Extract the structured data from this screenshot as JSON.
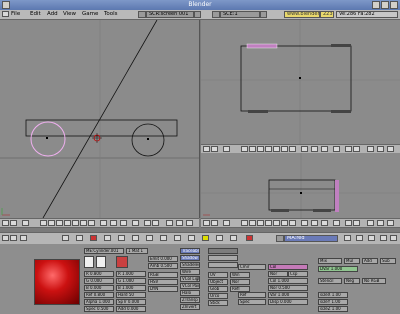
{
  "window": {
    "title": "Blender"
  },
  "menu": {
    "file": "File",
    "edit": "Edit",
    "add": "Add",
    "view": "View",
    "game": "Game",
    "tools": "Tools"
  },
  "screen_selector": "SCR:screen 001",
  "scene_selector": "SCE:1",
  "url_label": "www.blender.nl",
  "version_number": "223",
  "stats": "Ve:286 Fa:282",
  "viewport_top_right": {
    "cube_front_label": "|||||||||||||||",
    "cube_back_left": "|||||||||||",
    "cube_back_right": "|||||||||||"
  },
  "material": {
    "name": "MA:red",
    "ob_label": "ME:Cylinder.001",
    "slot": "1 Mat 1",
    "preset_tabs": [
      "RGB",
      "HSV",
      "DYN"
    ],
    "rgb": {
      "r": "R 0.800",
      "g": "G 0.000",
      "b": "B 0.000"
    },
    "spec": {
      "r": "R 1.000",
      "g": "G 1.000",
      "b": "B 1.000"
    },
    "params": [
      "Ref 0.800",
      "Alpha 1.000",
      "Spec 0.500",
      "Hard 50",
      "SpTr 0.000",
      "Add 0.000",
      "Emit 0.000",
      "Amb 0.500"
    ],
    "options": [
      "Traceable",
      "Shadow",
      "Shadeless",
      "Wire",
      "VCol Light",
      "VCol Paint",
      "Halo",
      "ZTransp",
      "ZInvert",
      "Env",
      "OnlyShadow",
      "No Mist"
    ],
    "mapping": [
      "UV",
      "Object",
      "Glob",
      "Orco",
      "Stick",
      "Win",
      "Nor",
      "Refl"
    ],
    "tex_channels": [
      "Col",
      "Nor",
      "Csp",
      "Cmir",
      "Ref",
      "Spec",
      "Hard",
      "Alpha",
      "Emit"
    ],
    "tex_values": [
      "Col 1.000",
      "Nor 0.500",
      "Var 1.000",
      "Disp 0.000",
      "sizeX 1.00",
      "sizeY 1.00",
      "sizeZ 1.00"
    ],
    "right_fields": [
      "Mix",
      "Mul",
      "Add",
      "Sub",
      "DVar 1.000",
      "Stencil",
      "Neg",
      "No RGB"
    ]
  },
  "colors": {
    "swatch": "#cc1111",
    "header_bg": "#b3b3b3",
    "viewport_bg": "#8b8b8b",
    "selected": "#ffd0ff"
  }
}
